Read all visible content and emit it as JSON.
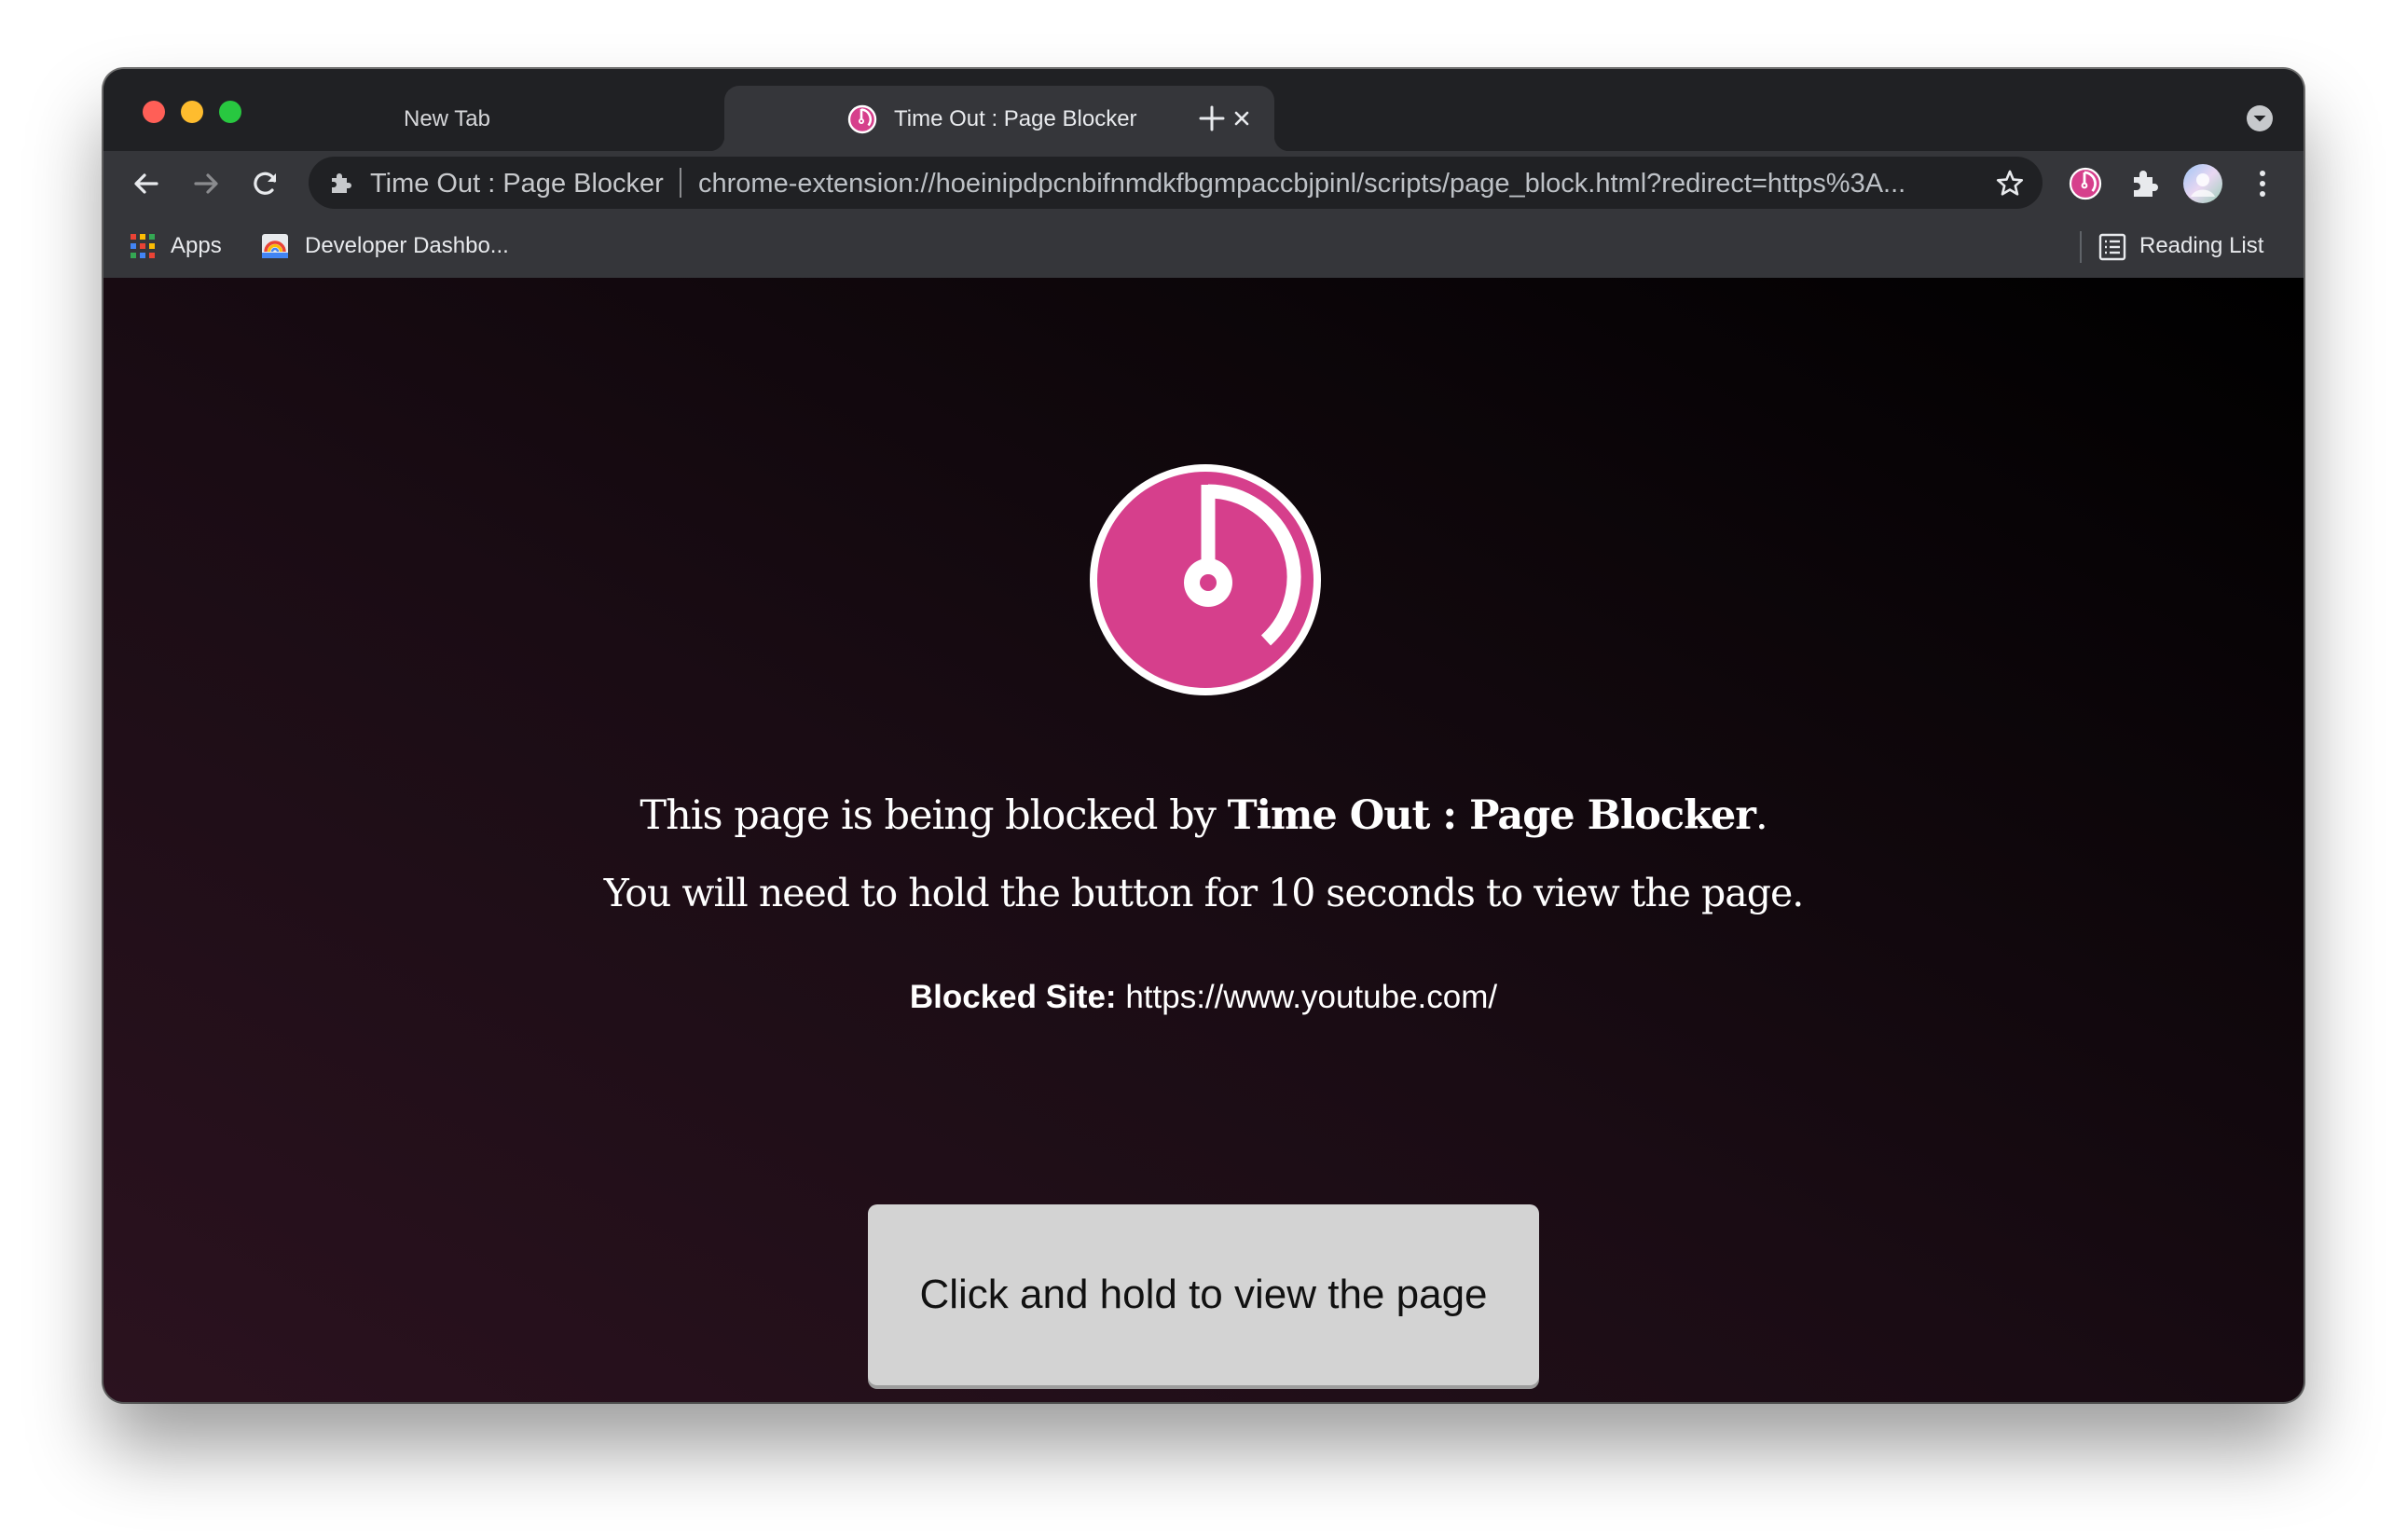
{
  "browser": {
    "tabs": [
      {
        "title": "New Tab",
        "active": false
      },
      {
        "title": "Time Out : Page Blocker",
        "active": true
      }
    ],
    "omnibox": {
      "site_chip": "Time Out : Page Blocker",
      "url": "chrome-extension://hoeinipdpcnbifnmdkfbgmpaccbjpinl/scripts/page_block.html?redirect=https%3A..."
    },
    "bookmarks": {
      "apps_label": "Apps",
      "developer_label": "Developer Dashbo...",
      "reading_list_label": "Reading List"
    }
  },
  "page": {
    "intro_text": "This page is being blocked by ",
    "extension_name": "Time Out : Page Blocker",
    "intro_end": ".",
    "instruction": "You will need to hold the button for 10 seconds to view the page.",
    "blocked_label": "Blocked Site:",
    "blocked_url": "https://www.youtube.com/",
    "button_label": "Click and hold to view the page"
  },
  "icons": {
    "traffic_lights": [
      "close",
      "minimize",
      "maximize"
    ],
    "tab_close": "close-icon",
    "new_tab": "plus-icon",
    "back": "back-arrow-icon",
    "forward": "forward-arrow-icon",
    "reload": "reload-icon",
    "bookmark_star": "star-icon",
    "extensions": "puzzle-icon",
    "profile": "avatar-icon",
    "menu": "kebab-menu-icon"
  },
  "colors": {
    "accent": "#d63f8c",
    "content_bg_dark": "#000000",
    "content_bg_plum": "#2b121f",
    "button_bg": "#d3d3d3"
  }
}
